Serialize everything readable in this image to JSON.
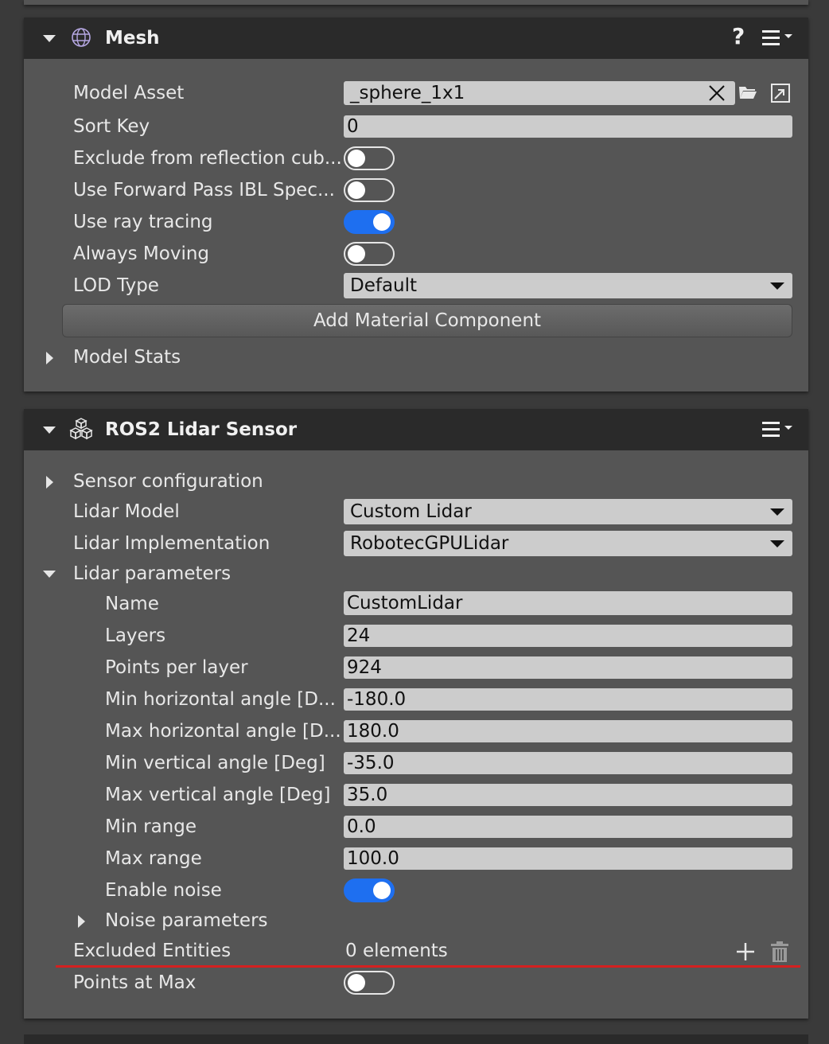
{
  "mesh": {
    "title": "Mesh",
    "help_icon": "help-icon",
    "menu_icon": "hamburger-menu-icon",
    "model_asset": {
      "label": "Model Asset",
      "value": "_sphere_1x1"
    },
    "sort_key": {
      "label": "Sort Key",
      "value": "0"
    },
    "exclude_reflection": {
      "label": "Exclude from reflection cub...",
      "on": false
    },
    "forward_pass": {
      "label": "Use Forward Pass IBL Spec...",
      "on": false
    },
    "ray_tracing": {
      "label": "Use ray tracing",
      "on": true
    },
    "always_moving": {
      "label": "Always Moving",
      "on": false
    },
    "lod_type": {
      "label": "LOD Type",
      "value": "Default"
    },
    "add_material_button": "Add Material Component",
    "model_stats": "Model Stats"
  },
  "lidar": {
    "title": "ROS2 Lidar Sensor",
    "menu_icon": "hamburger-menu-icon",
    "sensor_configuration": "Sensor configuration",
    "lidar_model": {
      "label": "Lidar Model",
      "value": "Custom Lidar"
    },
    "lidar_implementation": {
      "label": "Lidar Implementation",
      "value": "RobotecGPULidar"
    },
    "lidar_parameters": "Lidar parameters",
    "params": {
      "name": {
        "label": "Name",
        "value": "CustomLidar"
      },
      "layers": {
        "label": "Layers",
        "value": "24"
      },
      "points_per_layer": {
        "label": "Points per layer",
        "value": "924"
      },
      "min_h_angle": {
        "label": "Min horizontal angle [D...",
        "value": "-180.0"
      },
      "max_h_angle": {
        "label": "Max horizontal angle [D...",
        "value": "180.0"
      },
      "min_v_angle": {
        "label": "Min vertical angle [Deg]",
        "value": "-35.0"
      },
      "max_v_angle": {
        "label": "Max vertical angle [Deg]",
        "value": "35.0"
      },
      "min_range": {
        "label": "Min range",
        "value": "0.0"
      },
      "max_range": {
        "label": "Max range",
        "value": "100.0"
      },
      "enable_noise": {
        "label": "Enable noise",
        "on": true
      }
    },
    "noise_parameters": "Noise parameters",
    "excluded_entities": {
      "label": "Excluded Entities",
      "value": "0 elements"
    },
    "points_at_max": {
      "label": "Points at Max",
      "on": false
    }
  },
  "colors": {
    "accent": "#1e6ff0",
    "highlight_line": "#d42020",
    "panel_bg": "#555555",
    "header_bg": "#2a2a2a"
  }
}
